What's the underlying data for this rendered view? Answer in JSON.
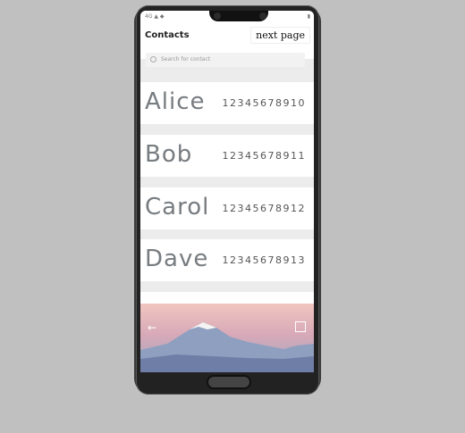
{
  "status": {
    "left": "4G ▲ ◆",
    "right": "▮"
  },
  "header": {
    "title": "Contacts",
    "next_label": "next page"
  },
  "search": {
    "placeholder": "Search for contact"
  },
  "contacts": [
    {
      "name": "Alice",
      "number": "12345678910"
    },
    {
      "name": "Bob",
      "number": "12345678911"
    },
    {
      "name": "Carol",
      "number": "12345678912"
    },
    {
      "name": "Dave",
      "number": "12345678913"
    }
  ],
  "colors": {
    "accent": "#777c80",
    "background": "#c0c0c0"
  }
}
